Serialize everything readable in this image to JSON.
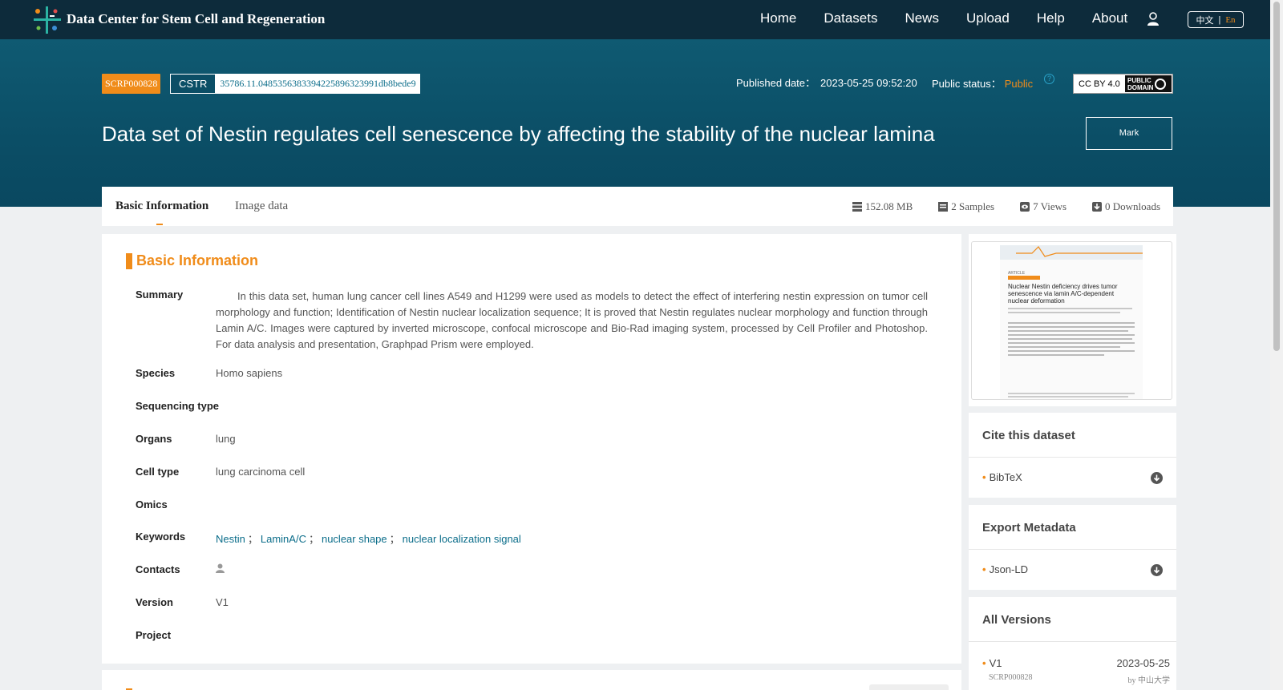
{
  "brand": "Data Center for Stem Cell and Regeneration",
  "nav": [
    "Home",
    "Datasets",
    "News",
    "Upload",
    "Help",
    "About"
  ],
  "lang": {
    "zh": "中文",
    "sep": "|",
    "en": "En"
  },
  "hero": {
    "id_tag": "SCRP000828",
    "cstr_label": "CSTR",
    "cstr_value": "35786.11.0485356383394225896323991db8bede9",
    "published_label": "Published date：",
    "published_value": "2023-05-25 09:52:20",
    "status_label": "Public status：",
    "status_value": "Public",
    "license_cc": "CC BY 4.0",
    "license_pd_1": "PUBLIC",
    "license_pd_2": "DOMAIN",
    "title": "Data set of Nestin regulates cell senescence by affecting the stability of the nuclear lamina",
    "mark_label": "Mark"
  },
  "tabs": {
    "basic": "Basic Information",
    "image": "Image data"
  },
  "stats": {
    "size": "152.08 MB",
    "samples": "2 Samples",
    "views": "7 Views",
    "downloads": "0 Downloads"
  },
  "basic": {
    "section_title": "Basic Information",
    "summary_label": "Summary",
    "summary": "In this data set, human lung cancer cell lines A549 and H1299 were used as models to detect the effect of interfering nestin expression on tumor cell morphology and function; Identification of Nestin nuclear localization sequence; It is proved that Nestin regulates nuclear morphology and function through Lamin A/C. Images were captured by inverted microscope, confocal microscope and Bio-Rad imaging system, processed by Cell Profiler and Photoshop. For data analysis and presentation, Graphpad Prism were employed.",
    "species_label": "Species",
    "species": "Homo sapiens",
    "seq_label": "Sequencing type",
    "organs_label": "Organs",
    "organs": "lung",
    "celltype_label": "Cell type",
    "celltype": "lung carcinoma cell",
    "omics_label": "Omics",
    "keywords_label": "Keywords",
    "keywords": [
      "Nestin",
      "LaminA/C",
      "nuclear shape",
      "nuclear localization signal"
    ],
    "kw_sep": "；",
    "contacts_label": "Contacts",
    "version_label": "Version",
    "version": "V1",
    "project_label": "Project"
  },
  "sidebar": {
    "paper_title": "Nuclear Nestin deficiency drives tumor senescence via lamin A/C-dependent nuclear deformation",
    "paper_kicker": "ARTICLE",
    "cite_title": "Cite this dataset",
    "cite_item": "BibTeX",
    "export_title": "Export Metadata",
    "export_item": "Json-LD",
    "versions_title": "All Versions",
    "version_name": "V1",
    "version_date": "2023-05-25",
    "version_id": "SCRP000828",
    "version_org": "by 中山大学"
  },
  "colors": {
    "accent": "#f08c1a",
    "nav_bg": "#0d2b3b",
    "hero_bg": "#0b4e66",
    "link": "#0b6d8a"
  }
}
